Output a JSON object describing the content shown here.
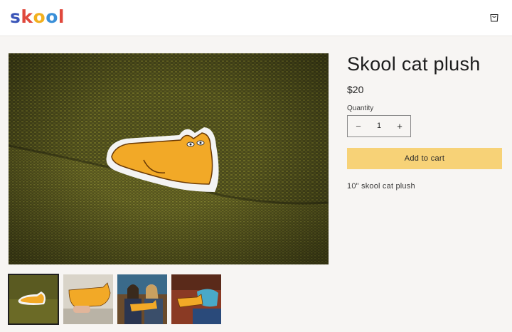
{
  "header": {
    "logo_letters": [
      {
        "char": "s",
        "color": "#3a55b8"
      },
      {
        "char": "k",
        "color": "#e0483c"
      },
      {
        "char": "o",
        "color": "#f2b01e"
      },
      {
        "char": "o",
        "color": "#3a8fd8"
      },
      {
        "char": "l",
        "color": "#e0483c"
      }
    ],
    "cart_icon": "shopping-bag-icon"
  },
  "product": {
    "title": "Skool cat plush",
    "price": "$20",
    "quantity_label": "Quantity",
    "quantity_value": "1",
    "minus_symbol": "−",
    "plus_symbol": "+",
    "add_to_cart_label": "Add to cart",
    "description": "10\" skool cat plush"
  },
  "gallery": {
    "active_index": 0,
    "thumbnails": [
      {
        "name": "cat-plush-on-couch"
      },
      {
        "name": "cat-plush-held-by-hand"
      },
      {
        "name": "two-women-holding-plush"
      },
      {
        "name": "plush-with-blue-pillow"
      }
    ]
  },
  "colors": {
    "accent_button": "#f7d277",
    "background": "#f7f5f3"
  }
}
